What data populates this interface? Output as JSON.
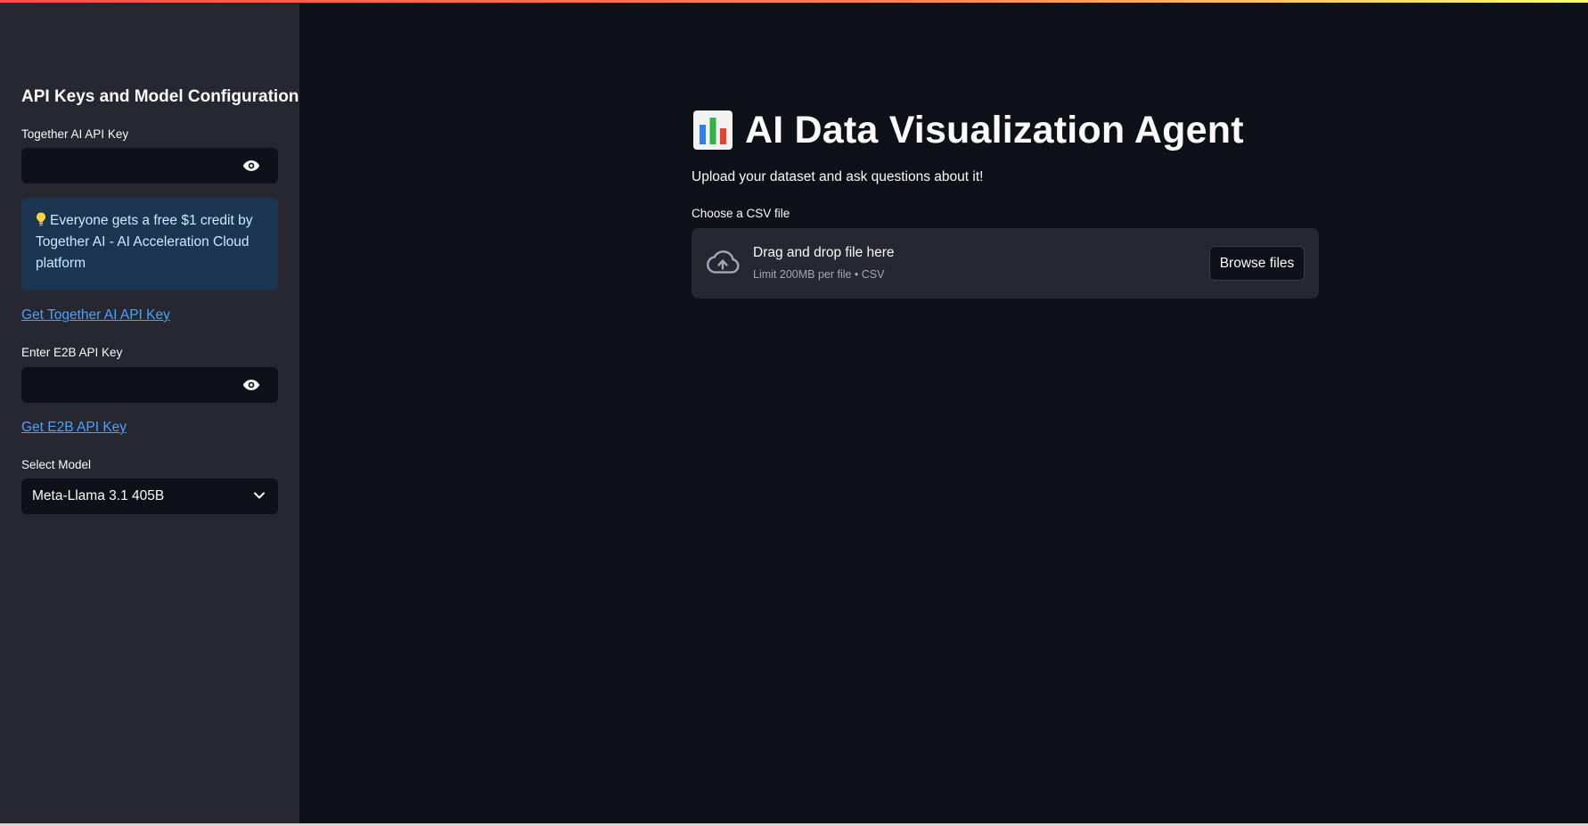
{
  "sidebar": {
    "title": "API Keys and Model Configuration",
    "together_key_label": "Together AI API Key",
    "together_key_value": "",
    "info_text": "Everyone gets a free $1 credit by Together AI - AI Acceleration Cloud platform",
    "together_link": "Get Together AI API Key",
    "e2b_key_label": "Enter E2B API Key",
    "e2b_key_value": "",
    "e2b_link": "Get E2B API Key",
    "model_label": "Select Model",
    "model_selected": "Meta-Llama 3.1 405B"
  },
  "main": {
    "title": "AI Data Visualization Agent",
    "subtitle": "Upload your dataset and ask questions about it!",
    "uploader": {
      "label": "Choose a CSV file",
      "drop_title": "Drag and drop file here",
      "drop_limit": "Limit 200MB per file • CSV",
      "browse_label": "Browse files"
    }
  },
  "icons": {
    "title_icon": "bar-chart-emoji",
    "password_toggle": "eye-icon",
    "info": "lightbulb-icon",
    "select": "chevron-down-icon",
    "upload": "cloud-upload-icon"
  },
  "colors": {
    "app_bg": "#0e1117",
    "sidebar_bg": "#262730",
    "info_bg": "#1c3550",
    "info_text": "#c7ebff",
    "link": "#4aa3ff",
    "accent_bar_start": "#ff4b4b",
    "accent_bar_end": "#fffd80"
  }
}
